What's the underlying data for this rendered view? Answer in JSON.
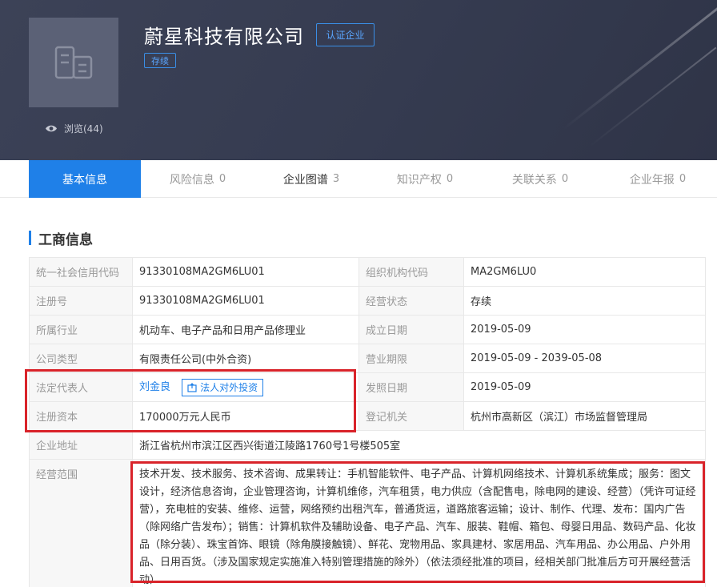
{
  "header": {
    "company_name": "蔚星科技有限公司",
    "cert_label": "认证企业",
    "status_tag": "存续",
    "views_label": "浏览(44)"
  },
  "tabs": [
    {
      "label": "基本信息",
      "count": ""
    },
    {
      "label": "风险信息",
      "count": "0"
    },
    {
      "label": "企业图谱",
      "count": "3"
    },
    {
      "label": "知识产权",
      "count": "0"
    },
    {
      "label": "关联关系",
      "count": "0"
    },
    {
      "label": "企业年报",
      "count": "0"
    }
  ],
  "section": {
    "title": "工商信息"
  },
  "info": {
    "credit_code_label": "统一社会信用代码",
    "credit_code": "91330108MA2GM6LU01",
    "org_code_label": "组织机构代码",
    "org_code": "MA2GM6LU0",
    "reg_no_label": "注册号",
    "reg_no": "91330108MA2GM6LU01",
    "biz_status_label": "经营状态",
    "biz_status": "存续",
    "industry_label": "所属行业",
    "industry": "机动车、电子产品和日用产品修理业",
    "found_date_label": "成立日期",
    "found_date": "2019-05-09",
    "company_type_label": "公司类型",
    "company_type": "有限责任公司(中外合资)",
    "biz_term_label": "营业期限",
    "biz_term": "2019-05-09 - 2039-05-08",
    "legal_rep_label": "法定代表人",
    "legal_rep": "刘金良",
    "invest_btn": "法人对外投资",
    "issue_date_label": "发照日期",
    "issue_date": "2019-05-09",
    "reg_capital_label": "注册资本",
    "reg_capital": "170000万元人民币",
    "reg_authority_label": "登记机关",
    "reg_authority": "杭州市高新区（滨江）市场监督管理局",
    "address_label": "企业地址",
    "address": "浙江省杭州市滨江区西兴街道江陵路1760号1号楼505室",
    "scope_label": "经营范围",
    "scope": "技术开发、技术服务、技术咨询、成果转让：手机智能软件、电子产品、计算机网络技术、计算机系统集成；服务：图文设计，经济信息咨询，企业管理咨询，计算机维修，汽车租赁，电力供应（含配售电，除电网的建设、经营）（凭许可证经营），充电桩的安装、维修、运营，网络预约出租汽车，普通货运，道路旅客运输；设计、制作、代理、发布：国内广告（除网络广告发布）；销售：计算机软件及辅助设备、电子产品、汽车、服装、鞋帽、箱包、母婴日用品、数码产品、化妆品（除分装）、珠宝首饰、眼镜（除角膜接触镜）、鲜花、宠物用品、家具建材、家居用品、汽车用品、办公用品、户外用品、日用百货。（涉及国家规定实施准入特别管理措施的除外）（依法须经批准的项目，经相关部门批准后方可开展经营活动）"
  },
  "colors": {
    "accent": "#1f80e8",
    "header_bg": "#3a4054",
    "highlight": "#d9232a"
  }
}
